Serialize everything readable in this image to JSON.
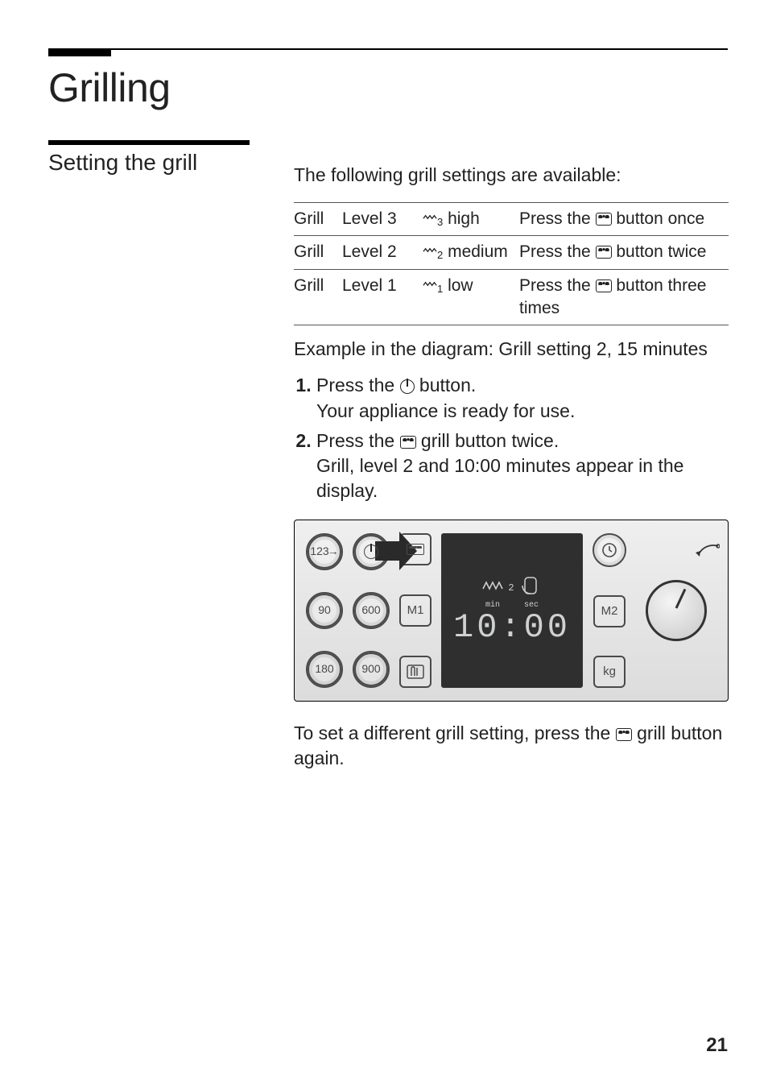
{
  "page": {
    "title": "Grilling",
    "section_heading": "Setting the grill",
    "intro": "The following grill settings are available:",
    "example": "Example in the diagram: Grill setting 2, 15 minutes",
    "after": [
      "To set a different grill setting, press the ",
      " grill button again."
    ],
    "pagenum": "21"
  },
  "table": {
    "rows": [
      {
        "c1": "Grill",
        "c2": "Level 3",
        "c3sub": "3",
        "c3": "high",
        "c4a": "Press the ",
        "c4b": " button once"
      },
      {
        "c1": "Grill",
        "c2": "Level 2",
        "c3sub": "2",
        "c3": "medium",
        "c4a": "Press the ",
        "c4b": " button twice"
      },
      {
        "c1": "Grill",
        "c2": "Level 1",
        "c3sub": "1",
        "c3": "low",
        "c4a": "Press the ",
        "c4b": " button three times"
      }
    ]
  },
  "steps": {
    "s1a": "Press the ",
    "s1b": " button.",
    "s1c": "Your appliance is ready for use.",
    "s2a": "Press the ",
    "s2b": " grill button twice.",
    "s2c": "Grill, level 2 and 10:00 minutes appear in the display."
  },
  "panel": {
    "btn_123": "123",
    "btn_90": "90",
    "btn_600": "600",
    "btn_180": "180",
    "btn_900": "900",
    "btn_m1": "M1",
    "btn_m2": "M2",
    "btn_kg": "kg",
    "disp_min": "min",
    "disp_sec": "sec",
    "disp_time": "10:00",
    "disp_level": "2"
  }
}
